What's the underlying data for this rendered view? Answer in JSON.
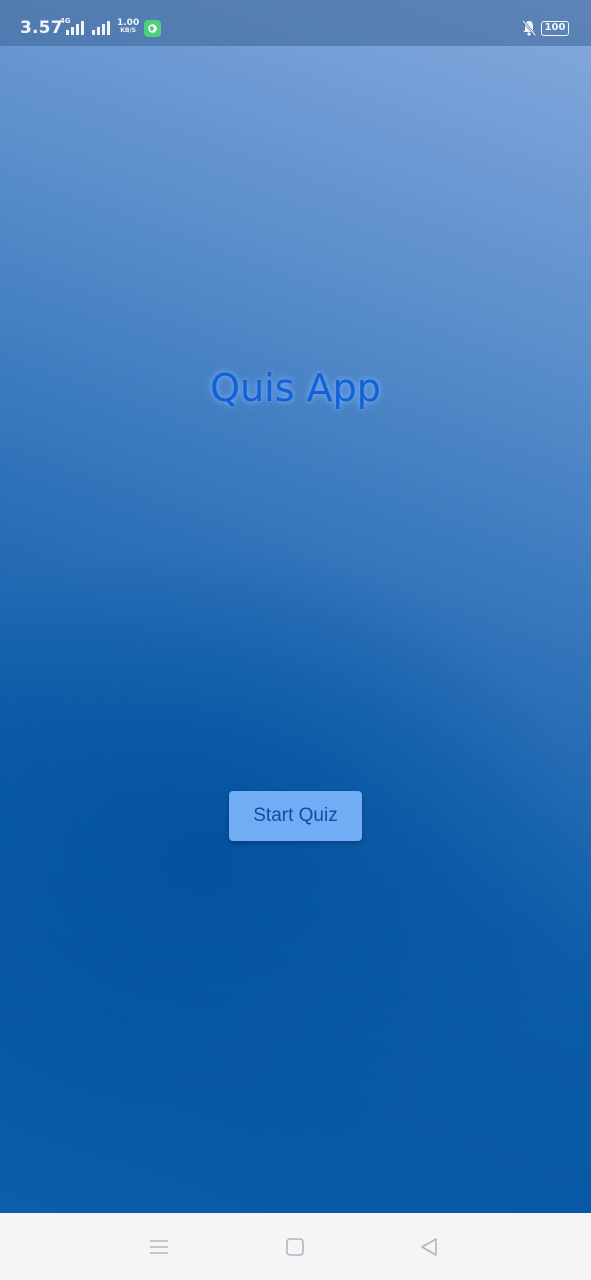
{
  "status_bar": {
    "time": "3.57",
    "network_type": "4G",
    "net_speed_value": "1.00",
    "net_speed_unit": "KB/S",
    "battery_level": "100",
    "icons": [
      "signal-icon",
      "signal-icon",
      "app-notification-icon",
      "mute-icon",
      "battery-icon"
    ]
  },
  "main": {
    "title": "Quis App",
    "start_button_label": "Start Quiz"
  },
  "nav_bar": {
    "icons": [
      "menu-icon",
      "home-icon",
      "back-icon"
    ]
  },
  "colors": {
    "background_top": "#86a9de",
    "background_bottom": "#0758a6",
    "title": "#1162d4",
    "button_bg": "#70adf5",
    "button_text": "#0e4da0"
  }
}
